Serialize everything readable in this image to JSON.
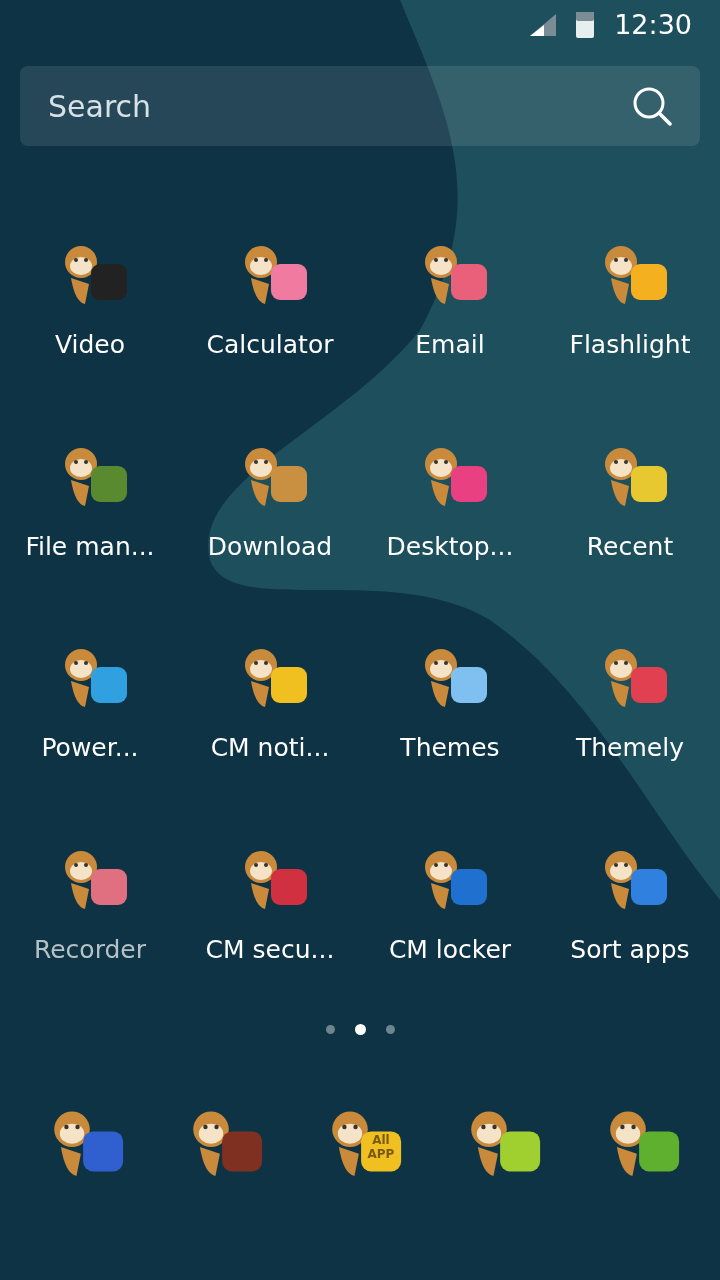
{
  "status_bar": {
    "time": "12:30"
  },
  "search": {
    "placeholder": "Search"
  },
  "apps": [
    {
      "label": "Video",
      "color": "#222222",
      "disabled": false
    },
    {
      "label": "Calculator",
      "color": "#f07aa0",
      "disabled": false
    },
    {
      "label": "Email",
      "color": "#e8607a",
      "disabled": false
    },
    {
      "label": "Flashlight",
      "color": "#f5b020",
      "disabled": false
    },
    {
      "label": "File man...",
      "color": "#5a8a30",
      "disabled": false
    },
    {
      "label": "Download",
      "color": "#c89040",
      "disabled": false
    },
    {
      "label": "Desktop...",
      "color": "#e84080",
      "disabled": false
    },
    {
      "label": "Recent",
      "color": "#e8c830",
      "disabled": false
    },
    {
      "label": "Power...",
      "color": "#30a0e0",
      "disabled": false
    },
    {
      "label": "CM noti...",
      "color": "#f0c020",
      "disabled": false
    },
    {
      "label": "Themes",
      "color": "#80c0f0",
      "disabled": false
    },
    {
      "label": "Themely",
      "color": "#e04050",
      "disabled": false
    },
    {
      "label": "Recorder",
      "color": "#e07080",
      "disabled": true
    },
    {
      "label": "CM secu...",
      "color": "#d03040",
      "disabled": false
    },
    {
      "label": "CM locker",
      "color": "#2070d0",
      "disabled": false
    },
    {
      "label": "Sort apps",
      "color": "#3080e0",
      "disabled": false
    }
  ],
  "pages": [
    {
      "selected": false
    },
    {
      "selected": true
    },
    {
      "selected": false
    }
  ],
  "dock": [
    {
      "color": "#3060d0"
    },
    {
      "color": "#803020"
    },
    {
      "color": "#f0c020",
      "text": "All APP"
    },
    {
      "color": "#a0d030"
    },
    {
      "color": "#60b030"
    }
  ]
}
